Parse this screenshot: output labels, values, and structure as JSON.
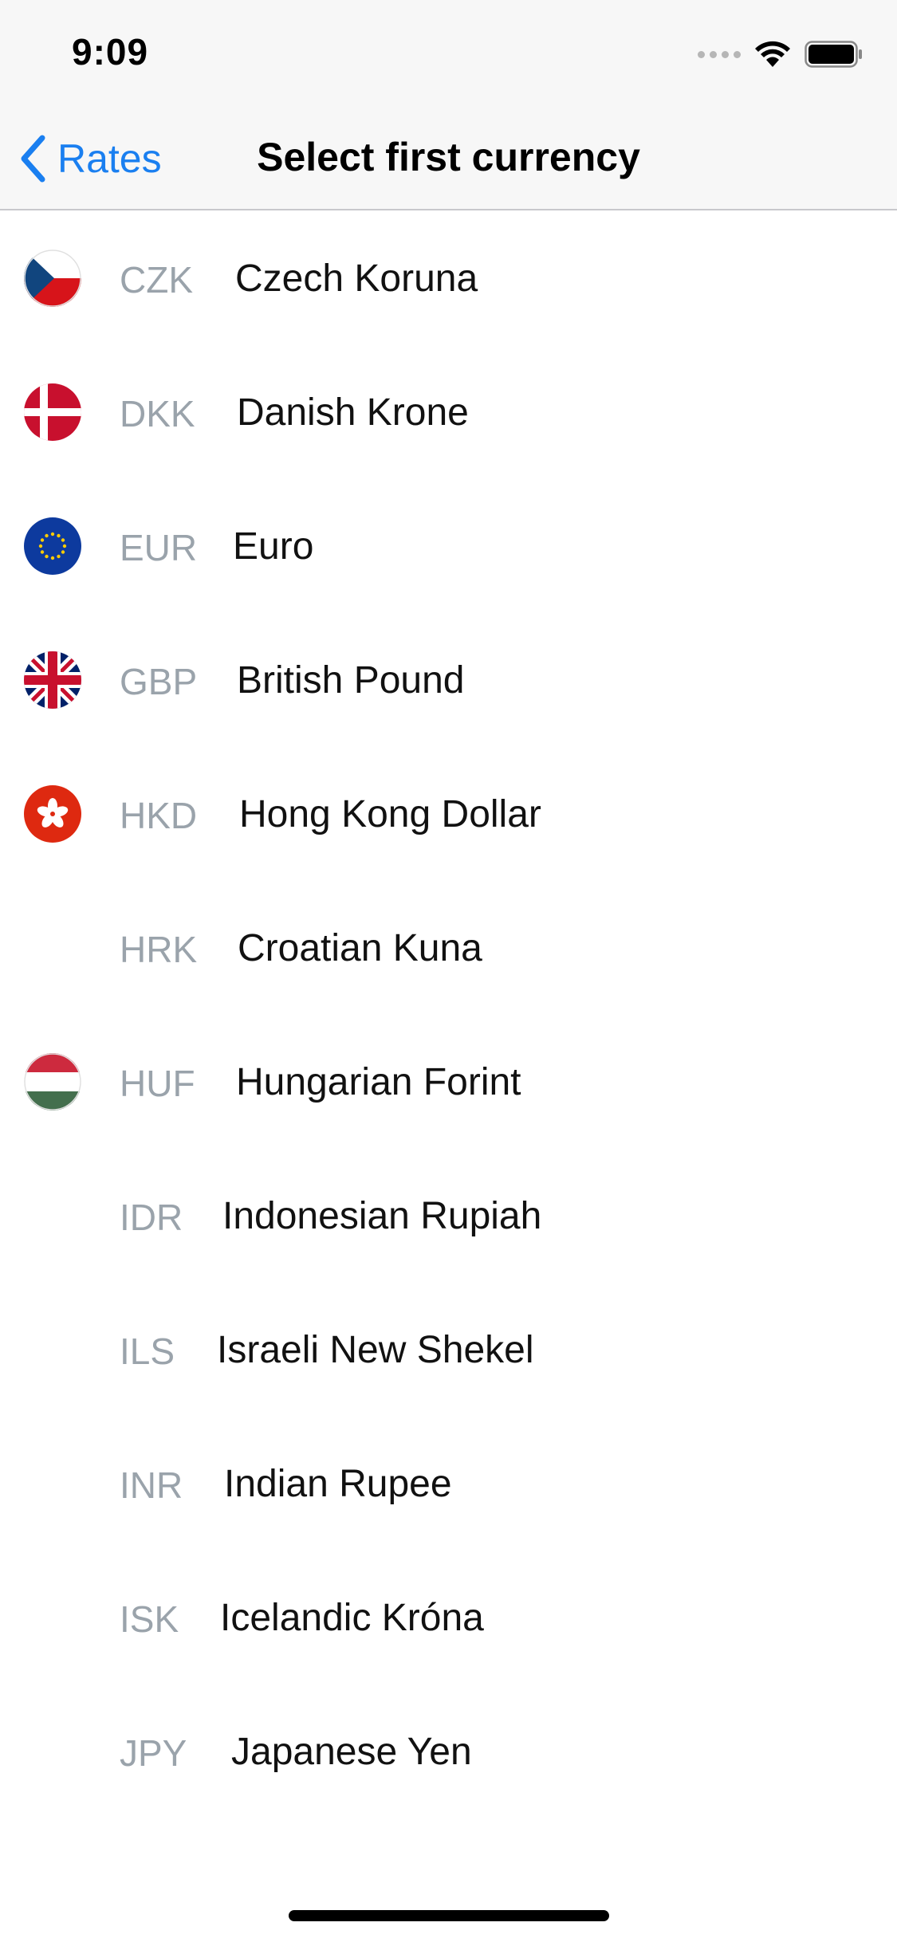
{
  "status_bar": {
    "time": "9:09"
  },
  "nav": {
    "back_label": "Rates",
    "title": "Select first currency"
  },
  "colors": {
    "accent": "#1a7ff0",
    "code_gray": "#9aa3ab"
  },
  "currencies": [
    {
      "code": "CZK",
      "name": "Czech Koruna",
      "flag_icon": "czech-flag-icon"
    },
    {
      "code": "DKK",
      "name": "Danish Krone",
      "flag_icon": "danish-flag-icon"
    },
    {
      "code": "EUR",
      "name": "Euro",
      "flag_icon": "eu-flag-icon"
    },
    {
      "code": "GBP",
      "name": "British Pound",
      "flag_icon": "uk-flag-icon"
    },
    {
      "code": "HKD",
      "name": "Hong Kong Dollar",
      "flag_icon": "hong-kong-flag-icon"
    },
    {
      "code": "HRK",
      "name": "Croatian Kuna",
      "flag_icon": ""
    },
    {
      "code": "HUF",
      "name": "Hungarian Forint",
      "flag_icon": "hungarian-flag-icon"
    },
    {
      "code": "IDR",
      "name": "Indonesian Rupiah",
      "flag_icon": ""
    },
    {
      "code": "ILS",
      "name": "Israeli New Shekel",
      "flag_icon": ""
    },
    {
      "code": "INR",
      "name": "Indian Rupee",
      "flag_icon": ""
    },
    {
      "code": "ISK",
      "name": "Icelandic Króna",
      "flag_icon": ""
    },
    {
      "code": "JPY",
      "name": "Japanese Yen",
      "flag_icon": ""
    }
  ]
}
